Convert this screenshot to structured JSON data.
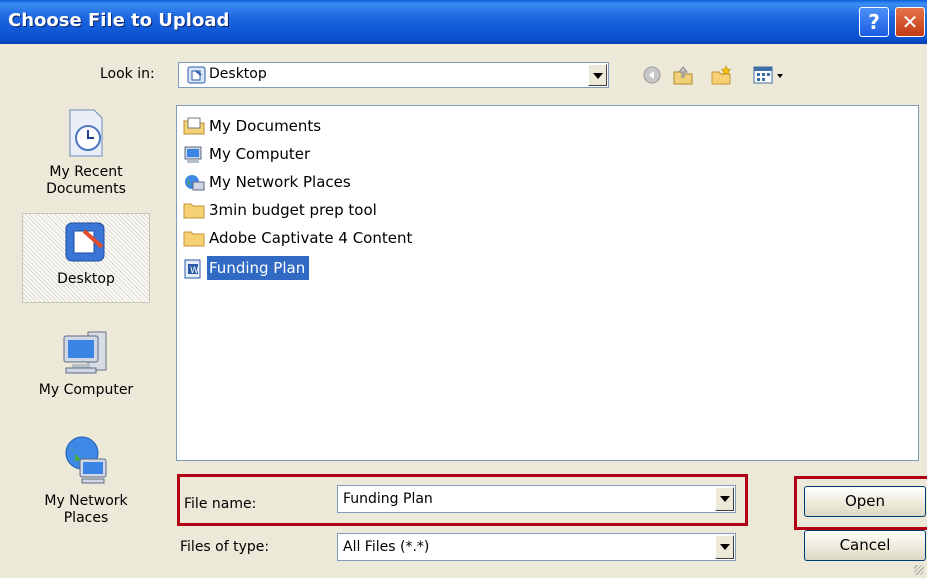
{
  "window": {
    "title": "Choose File to Upload",
    "help_label": "?",
    "close_label": "✕"
  },
  "lookin": {
    "label": "Look in:",
    "value": "Desktop"
  },
  "toolbar": {
    "icons": [
      "back-icon",
      "up-folder-icon",
      "new-folder-icon",
      "views-menu-icon"
    ]
  },
  "places": [
    {
      "label": "My Recent Documents",
      "line1": "My Recent",
      "line2": "Documents",
      "icon": "recent-documents-icon"
    },
    {
      "label": "Desktop",
      "line1": "Desktop",
      "line2": "",
      "icon": "desktop-icon",
      "selected": true
    },
    {
      "label": "My Computer",
      "line1": "My Computer",
      "line2": "",
      "icon": "my-computer-icon"
    },
    {
      "label": "My Network Places",
      "line1": "My Network",
      "line2": "Places",
      "icon": "network-places-icon"
    }
  ],
  "files": [
    {
      "name": "My Documents",
      "icon": "my-documents-icon"
    },
    {
      "name": "My Computer",
      "icon": "my-computer-icon"
    },
    {
      "name": "My Network Places",
      "icon": "network-places-icon"
    },
    {
      "name": "3min budget prep tool",
      "icon": "folder-icon"
    },
    {
      "name": "Adobe Captivate 4 Content",
      "icon": "folder-icon"
    },
    {
      "name": "Funding Plan",
      "icon": "word-document-icon",
      "selected": true
    }
  ],
  "filename": {
    "label": "File name:",
    "value": "Funding Plan"
  },
  "filetype": {
    "label": "Files of type:",
    "value": "All Files (*.*)"
  },
  "buttons": {
    "open": "Open",
    "cancel": "Cancel"
  },
  "colors": {
    "title_bar": "#0a5fd8",
    "selection": "#316ac5",
    "highlight_box": "#b00012",
    "dialog_bg": "#ece9d8"
  }
}
